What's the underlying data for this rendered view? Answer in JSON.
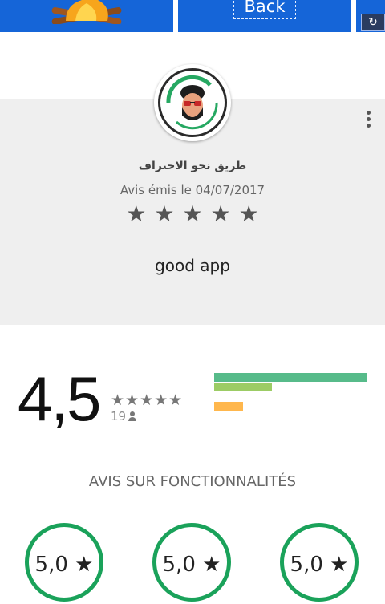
{
  "screenshots": {
    "back_label": "Back",
    "refresh_glyph": "↻"
  },
  "review": {
    "reviewer_name": "طريق نحو الاحتراف",
    "date_text": "Avis émis le 04/07/2017",
    "stars": "★★★★★",
    "rating": 5,
    "text": "good  app"
  },
  "summary": {
    "average": "4,5",
    "stars": "★★★★★",
    "rating_value": 4.5,
    "count": "19",
    "distribution": [
      {
        "stars": 5,
        "fraction": 1.0,
        "color": "#57bb8a"
      },
      {
        "stars": 4,
        "fraction": 0.38,
        "color": "#9ccc65"
      },
      {
        "stars": 3,
        "fraction": 0.0,
        "color": "#ffeb3b"
      },
      {
        "stars": 2,
        "fraction": 0.19,
        "color": "#ffb74d"
      },
      {
        "stars": 1,
        "fraction": 0.0,
        "color": "#ff8a65"
      }
    ]
  },
  "features": {
    "title": "AVIS SUR FONCTIONNALITÉS",
    "items": [
      {
        "value": "5,0 ★"
      },
      {
        "value": "5,0 ★"
      },
      {
        "value": "5,0 ★"
      }
    ]
  }
}
